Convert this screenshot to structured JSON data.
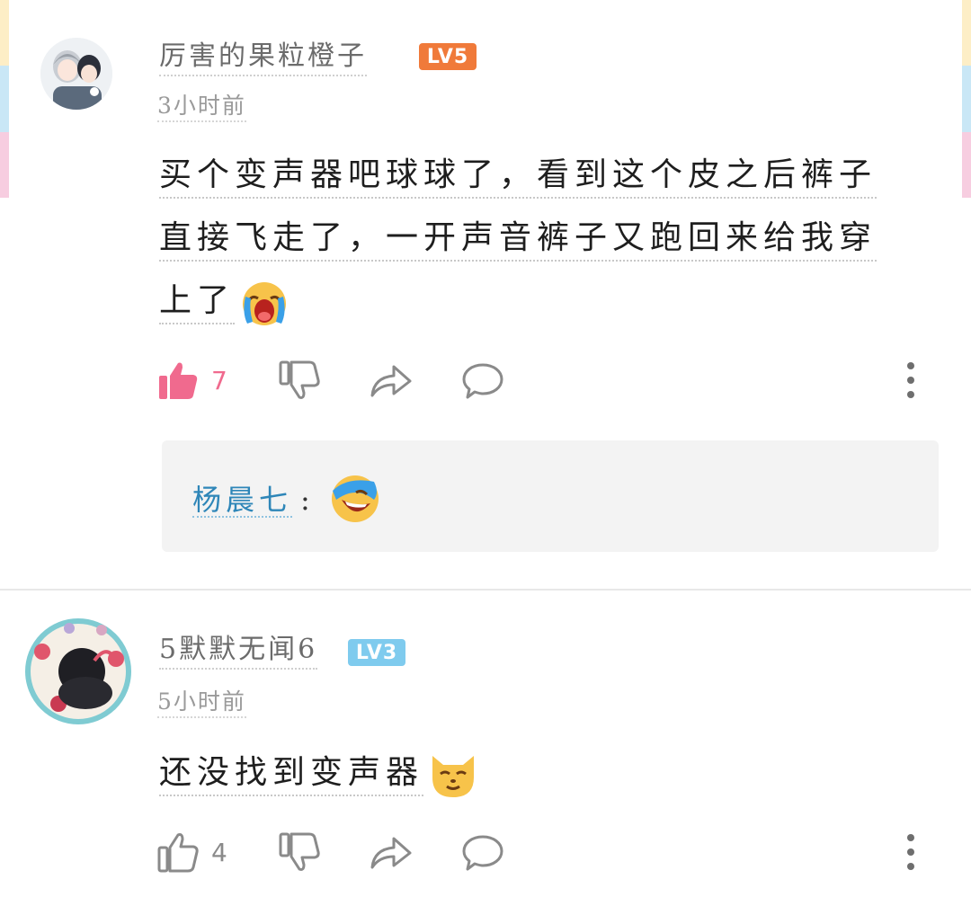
{
  "comments": [
    {
      "username": "厉害的果粒橙子",
      "level": "LV5",
      "level_color": "#f07a3a",
      "timestamp": "3小时前",
      "body_lines": [
        "买个变声器吧球球了，看到这个皮之后裤子",
        "直接飞走了，一开声音裤子又跑回来给我穿",
        "上了"
      ],
      "emoji": "crying-emoji",
      "likes": "7",
      "liked": true,
      "like_color": "#f06a8e",
      "reply": {
        "author": "杨晨七",
        "separator": ":",
        "emoji": "laughing-emoji"
      }
    },
    {
      "username": "5默默无闻6",
      "level": "LV3",
      "level_color": "#7fcbee",
      "timestamp": "5小时前",
      "body_lines": [
        "还没找到变声器"
      ],
      "emoji": "smug-cat-emoji",
      "likes": "4",
      "liked": false
    }
  ],
  "icons": [
    "thumbs-up-icon",
    "thumbs-down-icon",
    "share-icon",
    "reply-bubble-icon",
    "more-vertical-icon"
  ],
  "edge_colors": [
    "#fdeec6",
    "#c9e7f6",
    "#f7cde0"
  ]
}
